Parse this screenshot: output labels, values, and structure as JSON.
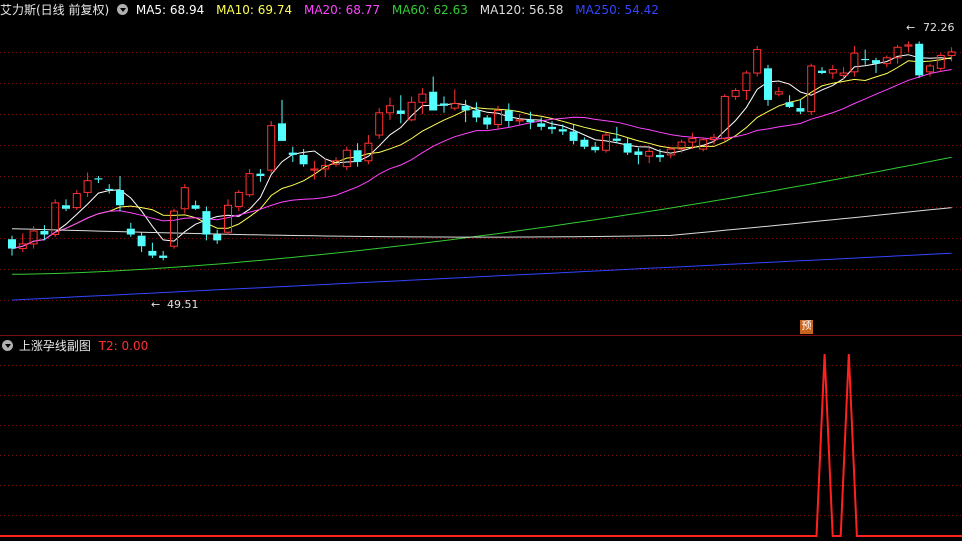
{
  "main_panel": {
    "stock_title": "艾力斯(日线 前复权)",
    "ma_legend": [
      {
        "label": "MA5: 68.94",
        "color": "#ffffff"
      },
      {
        "label": "MA10: 69.74",
        "color": "#ffff55"
      },
      {
        "label": "MA20: 68.77",
        "color": "#ff44ff"
      },
      {
        "label": "MA60: 62.63",
        "color": "#33cc33"
      },
      {
        "label": "MA120: 56.58",
        "color": "#dddddd"
      },
      {
        "label": "MA250: 54.42",
        "color": "#3344ff"
      }
    ],
    "high_marker": "72.26",
    "low_marker": "49.51",
    "forecast_badge": "预"
  },
  "sub_panel": {
    "indicator_title": "上涨孕线副图",
    "t2_label": "T2: 0.00"
  },
  "colors": {
    "up": "#ff3232",
    "down": "#54ffff",
    "grid": "#7a1010",
    "t2": "#ff2020"
  },
  "chart_data": {
    "type": "candlestick",
    "y_range": [
      47.5,
      74.5
    ],
    "candles": [
      [
        55.6,
        55.9,
        54.2,
        54.8
      ],
      [
        54.8,
        56.1,
        54.5,
        55.2
      ],
      [
        55.2,
        56.7,
        54.8,
        56.3
      ],
      [
        56.3,
        56.8,
        55.5,
        56.0
      ],
      [
        56.0,
        59.0,
        55.8,
        58.7
      ],
      [
        58.5,
        59.0,
        58.0,
        58.2
      ],
      [
        58.3,
        59.8,
        58.1,
        59.5
      ],
      [
        59.6,
        61.3,
        59.2,
        60.6
      ],
      [
        60.8,
        61.0,
        60.4,
        60.7
      ],
      [
        59.9,
        60.3,
        59.5,
        59.8
      ],
      [
        59.8,
        61.0,
        58.0,
        58.5
      ],
      [
        56.5,
        57.0,
        55.8,
        56.0
      ],
      [
        55.9,
        56.2,
        54.5,
        55.0
      ],
      [
        54.6,
        55.3,
        54.0,
        54.2
      ],
      [
        54.2,
        54.6,
        53.8,
        54.0
      ],
      [
        55.0,
        58.2,
        54.8,
        58.0
      ],
      [
        58.2,
        60.3,
        57.8,
        60.0
      ],
      [
        58.5,
        58.9,
        58.1,
        58.2
      ],
      [
        58.0,
        58.4,
        55.5,
        56.0
      ],
      [
        56.0,
        56.4,
        55.2,
        55.5
      ],
      [
        56.2,
        59.0,
        56.0,
        58.5
      ],
      [
        58.4,
        59.8,
        58.0,
        59.6
      ],
      [
        59.4,
        61.6,
        59.2,
        61.2
      ],
      [
        61.2,
        61.6,
        60.5,
        61.0
      ],
      [
        61.5,
        65.7,
        61.2,
        65.3
      ],
      [
        65.5,
        67.5,
        64.8,
        64.0
      ],
      [
        63.0,
        63.5,
        62.2,
        62.8
      ],
      [
        62.8,
        63.3,
        61.8,
        62.0
      ],
      [
        61.5,
        62.3,
        60.7,
        61.6
      ],
      [
        61.6,
        62.5,
        60.9,
        61.9
      ],
      [
        62.0,
        62.6,
        61.8,
        62.3
      ],
      [
        61.8,
        63.5,
        61.5,
        63.2
      ],
      [
        63.2,
        63.8,
        61.8,
        62.2
      ],
      [
        62.3,
        64.5,
        62.0,
        63.8
      ],
      [
        64.5,
        66.8,
        64.2,
        66.4
      ],
      [
        66.4,
        67.7,
        65.8,
        67.0
      ],
      [
        66.6,
        67.9,
        65.5,
        66.3
      ],
      [
        65.8,
        67.8,
        65.7,
        67.3
      ],
      [
        67.3,
        68.5,
        66.3,
        68.0
      ],
      [
        68.2,
        69.5,
        67.8,
        66.6
      ],
      [
        67.2,
        67.8,
        66.4,
        67.0
      ],
      [
        66.8,
        68.4,
        66.6,
        67.2
      ],
      [
        67.0,
        67.5,
        65.6,
        66.6
      ],
      [
        66.6,
        67.3,
        65.6,
        66.0
      ],
      [
        66.0,
        66.2,
        65.0,
        65.4
      ],
      [
        65.4,
        67.0,
        65.0,
        66.6
      ],
      [
        66.6,
        67.2,
        65.2,
        65.7
      ],
      [
        65.7,
        66.3,
        65.3,
        65.8
      ],
      [
        65.8,
        66.5,
        65.0,
        65.6
      ],
      [
        65.5,
        66.0,
        64.9,
        65.2
      ],
      [
        65.2,
        65.7,
        64.6,
        65.0
      ],
      [
        65.0,
        65.4,
        64.5,
        64.8
      ],
      [
        64.8,
        65.4,
        63.7,
        64.0
      ],
      [
        64.1,
        64.3,
        63.3,
        63.5
      ],
      [
        63.5,
        63.9,
        63.0,
        63.2
      ],
      [
        63.2,
        64.7,
        63.0,
        64.5
      ],
      [
        64.2,
        65.2,
        63.8,
        64.0
      ],
      [
        63.8,
        64.3,
        62.8,
        63.0
      ],
      [
        63.1,
        63.4,
        62.0,
        62.8
      ],
      [
        62.7,
        63.4,
        62.1,
        63.1
      ],
      [
        62.8,
        63.3,
        62.2,
        62.6
      ],
      [
        62.8,
        63.5,
        62.5,
        63.3
      ],
      [
        63.3,
        64.1,
        63.0,
        63.9
      ],
      [
        63.9,
        64.7,
        63.3,
        64.2
      ],
      [
        63.3,
        64.3,
        63.1,
        64.1
      ],
      [
        64.1,
        64.6,
        63.7,
        64.3
      ],
      [
        64.2,
        68.0,
        64.0,
        67.8
      ],
      [
        67.8,
        68.5,
        67.5,
        68.3
      ],
      [
        68.3,
        70.0,
        67.5,
        69.8
      ],
      [
        69.8,
        72.1,
        69.5,
        71.8
      ],
      [
        70.2,
        70.5,
        67.0,
        67.5
      ],
      [
        68.0,
        68.6,
        67.8,
        68.2
      ],
      [
        67.3,
        67.9,
        66.8,
        66.9
      ],
      [
        66.8,
        67.5,
        66.3,
        66.5
      ],
      [
        66.5,
        70.6,
        66.2,
        70.4
      ],
      [
        70.0,
        70.3,
        69.7,
        69.8
      ],
      [
        69.8,
        70.5,
        69.3,
        70.1
      ],
      [
        69.6,
        70.3,
        69.3,
        69.8
      ],
      [
        69.9,
        72.1,
        69.5,
        71.5
      ],
      [
        71.0,
        71.8,
        70.5,
        70.9
      ],
      [
        70.9,
        71.1,
        69.8,
        70.6
      ],
      [
        70.6,
        71.3,
        70.3,
        71.1
      ],
      [
        71.1,
        72.2,
        70.6,
        72.0
      ],
      [
        72.1,
        72.5,
        71.6,
        72.2
      ],
      [
        72.3,
        72.5,
        69.4,
        69.6
      ],
      [
        69.9,
        70.6,
        69.5,
        70.4
      ],
      [
        70.2,
        71.5,
        69.9,
        71.3
      ],
      [
        71.3,
        72.0,
        70.8,
        71.6
      ]
    ],
    "t2_values": [
      0,
      0,
      0,
      0,
      0,
      0,
      0,
      0,
      0,
      0,
      0,
      0,
      0,
      0,
      0,
      0,
      0,
      0,
      0,
      0,
      0,
      0,
      0,
      0,
      0,
      0,
      0,
      0,
      0,
      0,
      0,
      0,
      0,
      0,
      0,
      0,
      0,
      0,
      0,
      0,
      0,
      0,
      0,
      0,
      0,
      0,
      0,
      0,
      0,
      0,
      0,
      0,
      0,
      0,
      0,
      0,
      0,
      0,
      0,
      0,
      0,
      0,
      0,
      0,
      0,
      0,
      0,
      0,
      0,
      0,
      0,
      0,
      0,
      0,
      0,
      0,
      0,
      0,
      0,
      0,
      0,
      0,
      0,
      0,
      0,
      0,
      0,
      0,
      0,
      0,
      0,
      0,
      0,
      0,
      0,
      0,
      0,
      0,
      0,
      0,
      0,
      0,
      1,
      0,
      0,
      1,
      0,
      0,
      0,
      0,
      0,
      0,
      0,
      0,
      0,
      0,
      0,
      0,
      0,
      0
    ]
  }
}
